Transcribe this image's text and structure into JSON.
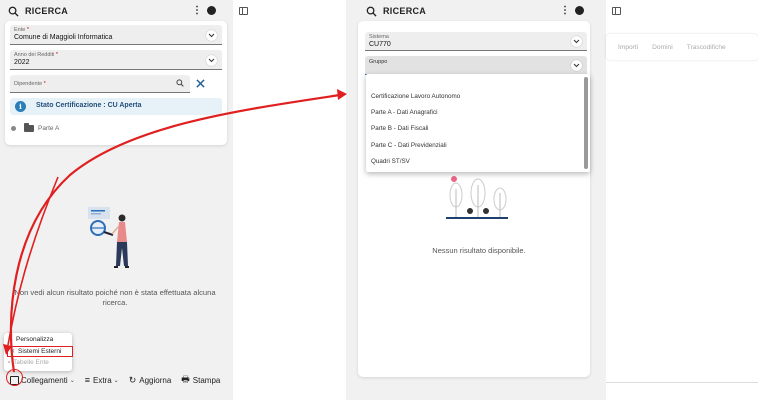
{
  "left": {
    "header": {
      "title": "RICERCA",
      "more": "⋮"
    },
    "ente": {
      "label": "Ente",
      "value": "Comune di Maggioli Informatica"
    },
    "anno": {
      "label": "Anno dei Redditi",
      "value": "2022"
    },
    "dipendente": {
      "label": "Dipendente"
    },
    "required_mark": "*",
    "status": {
      "icon": "i",
      "text": "Stato Certificazione : CU Aperta"
    },
    "tree": {
      "item": "Parte A"
    },
    "empty_message": "Non vedi alcun risultato poiché non è stata effettuata alcuna ricerca.",
    "menu": {
      "items": [
        "Personalizza",
        "Sistemi Esterni",
        "Tabelle Ente"
      ]
    },
    "bottom_bar": {
      "links": "Collegamenti",
      "extra": "Extra",
      "refresh": "Aggiorna",
      "print": "Stampa"
    }
  },
  "right": {
    "header": {
      "title": "RICERCA",
      "more": "⋮"
    },
    "sistema": {
      "label": "Sistema",
      "value": "CU770"
    },
    "gruppo": {
      "label": "Gruppo"
    },
    "dropdown_options": [
      "Certificazione Lavoro Autonomo",
      "Parte A - Dati Anagrafici",
      "Parte B - Dati Fiscali",
      "Parte C - Dati Previdenziali",
      "Quadri ST/SV"
    ],
    "no_result": "Nessun risultato disponibile."
  },
  "far_right": {
    "tabs": [
      "Importi",
      "Domini",
      "Trascodifiche"
    ]
  },
  "colors": {
    "annotation": "#e02020",
    "info": "#2a7fb8"
  }
}
